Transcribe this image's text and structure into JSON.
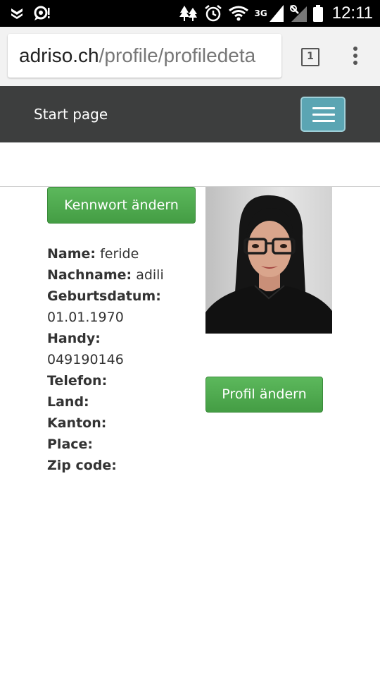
{
  "status_bar": {
    "network_label": "3G",
    "time": "12:11"
  },
  "browser": {
    "url_domain": "adriso.ch",
    "url_path": "/profile/profiledeta",
    "tab_count": "1"
  },
  "navbar": {
    "brand": "Start page"
  },
  "buttons": {
    "change_password": "Kennwort ändern",
    "edit_profile": "Profil ändern"
  },
  "profile": {
    "name_label": "Name:",
    "name_value": "feride",
    "surname_label": "Nachname:",
    "surname_value": "adili",
    "birthdate_label": "Geburtsdatum:",
    "birthdate_value": "01.01.1970",
    "mobile_label": "Handy:",
    "mobile_value": "049190146",
    "phone_label": "Telefon:",
    "country_label": "Land:",
    "canton_label": "Kanton:",
    "place_label": "Place:",
    "zip_label": "Zip code:"
  },
  "colors": {
    "navbar_bg": "#3d3e3e",
    "toggle_bg": "#5ba5b3",
    "button_green": "#4cae4c"
  },
  "icons": {
    "status_left": [
      "shield-notification-icon",
      "chat-notification-icon"
    ],
    "status_right": [
      "trees-icon",
      "alarm-icon",
      "wifi-icon",
      "signal-icon",
      "no-signal-icon",
      "battery-icon"
    ]
  }
}
